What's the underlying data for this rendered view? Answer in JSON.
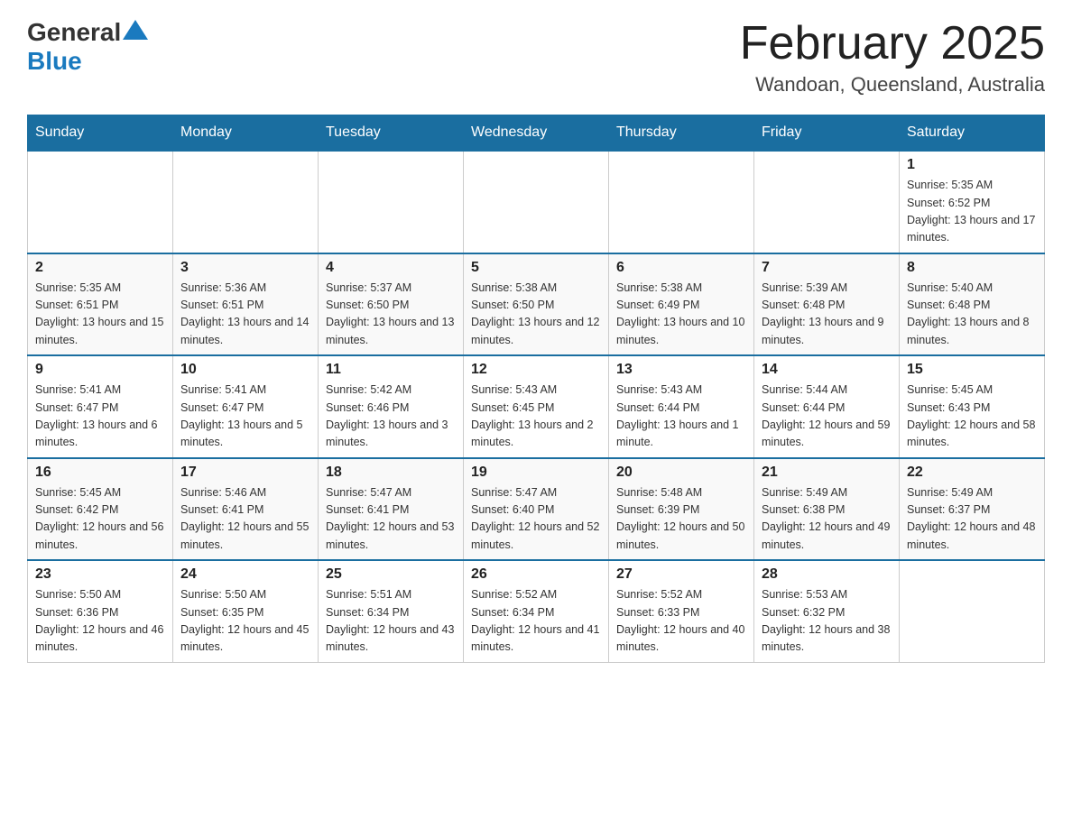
{
  "header": {
    "logo_general": "General",
    "logo_blue": "Blue",
    "month_title": "February 2025",
    "location": "Wandoan, Queensland, Australia"
  },
  "weekdays": [
    "Sunday",
    "Monday",
    "Tuesday",
    "Wednesday",
    "Thursday",
    "Friday",
    "Saturday"
  ],
  "weeks": [
    [
      {
        "day": "",
        "info": ""
      },
      {
        "day": "",
        "info": ""
      },
      {
        "day": "",
        "info": ""
      },
      {
        "day": "",
        "info": ""
      },
      {
        "day": "",
        "info": ""
      },
      {
        "day": "",
        "info": ""
      },
      {
        "day": "1",
        "info": "Sunrise: 5:35 AM\nSunset: 6:52 PM\nDaylight: 13 hours and 17 minutes."
      }
    ],
    [
      {
        "day": "2",
        "info": "Sunrise: 5:35 AM\nSunset: 6:51 PM\nDaylight: 13 hours and 15 minutes."
      },
      {
        "day": "3",
        "info": "Sunrise: 5:36 AM\nSunset: 6:51 PM\nDaylight: 13 hours and 14 minutes."
      },
      {
        "day": "4",
        "info": "Sunrise: 5:37 AM\nSunset: 6:50 PM\nDaylight: 13 hours and 13 minutes."
      },
      {
        "day": "5",
        "info": "Sunrise: 5:38 AM\nSunset: 6:50 PM\nDaylight: 13 hours and 12 minutes."
      },
      {
        "day": "6",
        "info": "Sunrise: 5:38 AM\nSunset: 6:49 PM\nDaylight: 13 hours and 10 minutes."
      },
      {
        "day": "7",
        "info": "Sunrise: 5:39 AM\nSunset: 6:48 PM\nDaylight: 13 hours and 9 minutes."
      },
      {
        "day": "8",
        "info": "Sunrise: 5:40 AM\nSunset: 6:48 PM\nDaylight: 13 hours and 8 minutes."
      }
    ],
    [
      {
        "day": "9",
        "info": "Sunrise: 5:41 AM\nSunset: 6:47 PM\nDaylight: 13 hours and 6 minutes."
      },
      {
        "day": "10",
        "info": "Sunrise: 5:41 AM\nSunset: 6:47 PM\nDaylight: 13 hours and 5 minutes."
      },
      {
        "day": "11",
        "info": "Sunrise: 5:42 AM\nSunset: 6:46 PM\nDaylight: 13 hours and 3 minutes."
      },
      {
        "day": "12",
        "info": "Sunrise: 5:43 AM\nSunset: 6:45 PM\nDaylight: 13 hours and 2 minutes."
      },
      {
        "day": "13",
        "info": "Sunrise: 5:43 AM\nSunset: 6:44 PM\nDaylight: 13 hours and 1 minute."
      },
      {
        "day": "14",
        "info": "Sunrise: 5:44 AM\nSunset: 6:44 PM\nDaylight: 12 hours and 59 minutes."
      },
      {
        "day": "15",
        "info": "Sunrise: 5:45 AM\nSunset: 6:43 PM\nDaylight: 12 hours and 58 minutes."
      }
    ],
    [
      {
        "day": "16",
        "info": "Sunrise: 5:45 AM\nSunset: 6:42 PM\nDaylight: 12 hours and 56 minutes."
      },
      {
        "day": "17",
        "info": "Sunrise: 5:46 AM\nSunset: 6:41 PM\nDaylight: 12 hours and 55 minutes."
      },
      {
        "day": "18",
        "info": "Sunrise: 5:47 AM\nSunset: 6:41 PM\nDaylight: 12 hours and 53 minutes."
      },
      {
        "day": "19",
        "info": "Sunrise: 5:47 AM\nSunset: 6:40 PM\nDaylight: 12 hours and 52 minutes."
      },
      {
        "day": "20",
        "info": "Sunrise: 5:48 AM\nSunset: 6:39 PM\nDaylight: 12 hours and 50 minutes."
      },
      {
        "day": "21",
        "info": "Sunrise: 5:49 AM\nSunset: 6:38 PM\nDaylight: 12 hours and 49 minutes."
      },
      {
        "day": "22",
        "info": "Sunrise: 5:49 AM\nSunset: 6:37 PM\nDaylight: 12 hours and 48 minutes."
      }
    ],
    [
      {
        "day": "23",
        "info": "Sunrise: 5:50 AM\nSunset: 6:36 PM\nDaylight: 12 hours and 46 minutes."
      },
      {
        "day": "24",
        "info": "Sunrise: 5:50 AM\nSunset: 6:35 PM\nDaylight: 12 hours and 45 minutes."
      },
      {
        "day": "25",
        "info": "Sunrise: 5:51 AM\nSunset: 6:34 PM\nDaylight: 12 hours and 43 minutes."
      },
      {
        "day": "26",
        "info": "Sunrise: 5:52 AM\nSunset: 6:34 PM\nDaylight: 12 hours and 41 minutes."
      },
      {
        "day": "27",
        "info": "Sunrise: 5:52 AM\nSunset: 6:33 PM\nDaylight: 12 hours and 40 minutes."
      },
      {
        "day": "28",
        "info": "Sunrise: 5:53 AM\nSunset: 6:32 PM\nDaylight: 12 hours and 38 minutes."
      },
      {
        "day": "",
        "info": ""
      }
    ]
  ]
}
